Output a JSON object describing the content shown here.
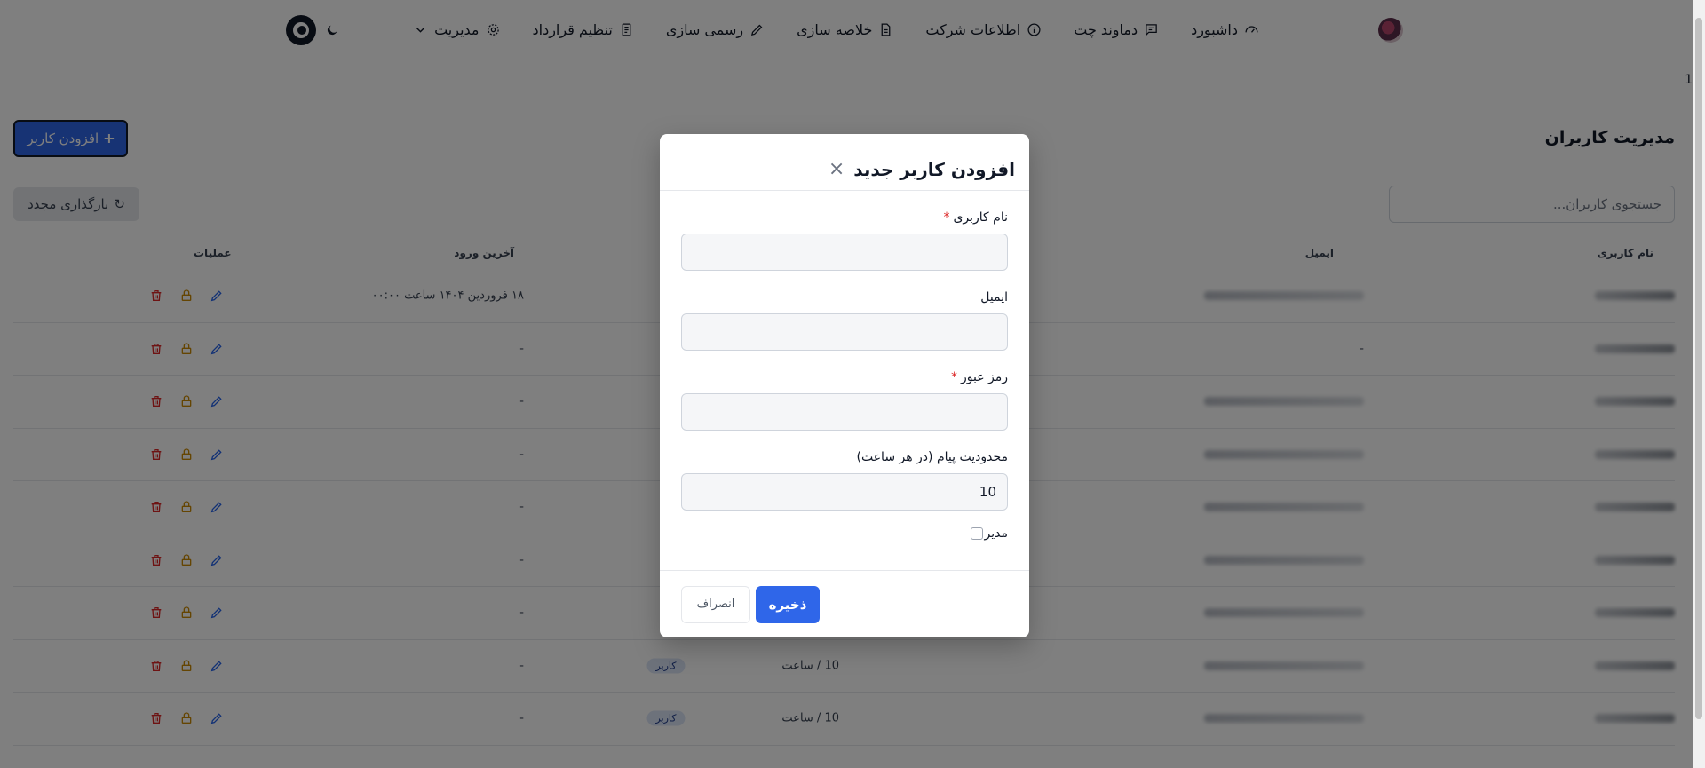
{
  "nav": {
    "items": [
      {
        "label": "داشبورد",
        "icon": "gauge-icon"
      },
      {
        "label": "دماوند چت",
        "icon": "chat-icon"
      },
      {
        "label": "اطلاعات شرکت",
        "icon": "info-icon"
      },
      {
        "label": "خلاصه سازی",
        "icon": "document-icon"
      },
      {
        "label": "رسمی سازی",
        "icon": "pen-icon"
      },
      {
        "label": "تنظیم قرارداد",
        "icon": "file-icon"
      },
      {
        "label": "مدیریت",
        "icon": "gear-icon"
      }
    ],
    "side_number": "1"
  },
  "page": {
    "title": "مدیریت کاربران",
    "add_user_label": "افزودن کاربر",
    "reload_label": "بارگذاری مجدد",
    "search_placeholder": "جستجوی کاربران..."
  },
  "table": {
    "headers": {
      "username": "نام کاربری",
      "email": "ایمیل",
      "last_login": "آخرین ورود",
      "actions": "عملیات"
    },
    "rows": [
      {
        "last_login": "۱۸ فروردین ۱۴۰۴ ساعت ۰۰:۰۰",
        "email_text": "",
        "limit": "",
        "role": ""
      },
      {
        "last_login": "-",
        "email_text": "-",
        "limit": "",
        "role": ""
      },
      {
        "last_login": "-",
        "email_text": "",
        "limit": "",
        "role": ""
      },
      {
        "last_login": "-",
        "email_text": "",
        "limit": "",
        "role": ""
      },
      {
        "last_login": "-",
        "email_text": "",
        "limit": "",
        "role": ""
      },
      {
        "last_login": "-",
        "email_text": "",
        "limit": "",
        "role": ""
      },
      {
        "last_login": "-",
        "email_text": "",
        "limit": "",
        "role": ""
      },
      {
        "last_login": "-",
        "email_text": "",
        "limit": "10 / ساعت",
        "role": "کاربر"
      },
      {
        "last_login": "-",
        "email_text": "",
        "limit": "10 / ساعت",
        "role": "کاربر"
      }
    ]
  },
  "modal": {
    "title": "افزودن کاربر جدید",
    "close_symbol": "×",
    "username_label": "نام کاربری",
    "email_label": "ایمیل",
    "password_label": "رمز عبور",
    "limit_label": "محدودیت پیام (در هر ساعت)",
    "limit_value": "10",
    "required_mark": "*",
    "admin_label": "مدیر",
    "save_label": "ذخیره",
    "cancel_label": "انصراف"
  },
  "colors": {
    "accent": "#2f66e9",
    "delete": "#dc2626",
    "lock": "#ca8a04",
    "edit": "#2563eb"
  }
}
